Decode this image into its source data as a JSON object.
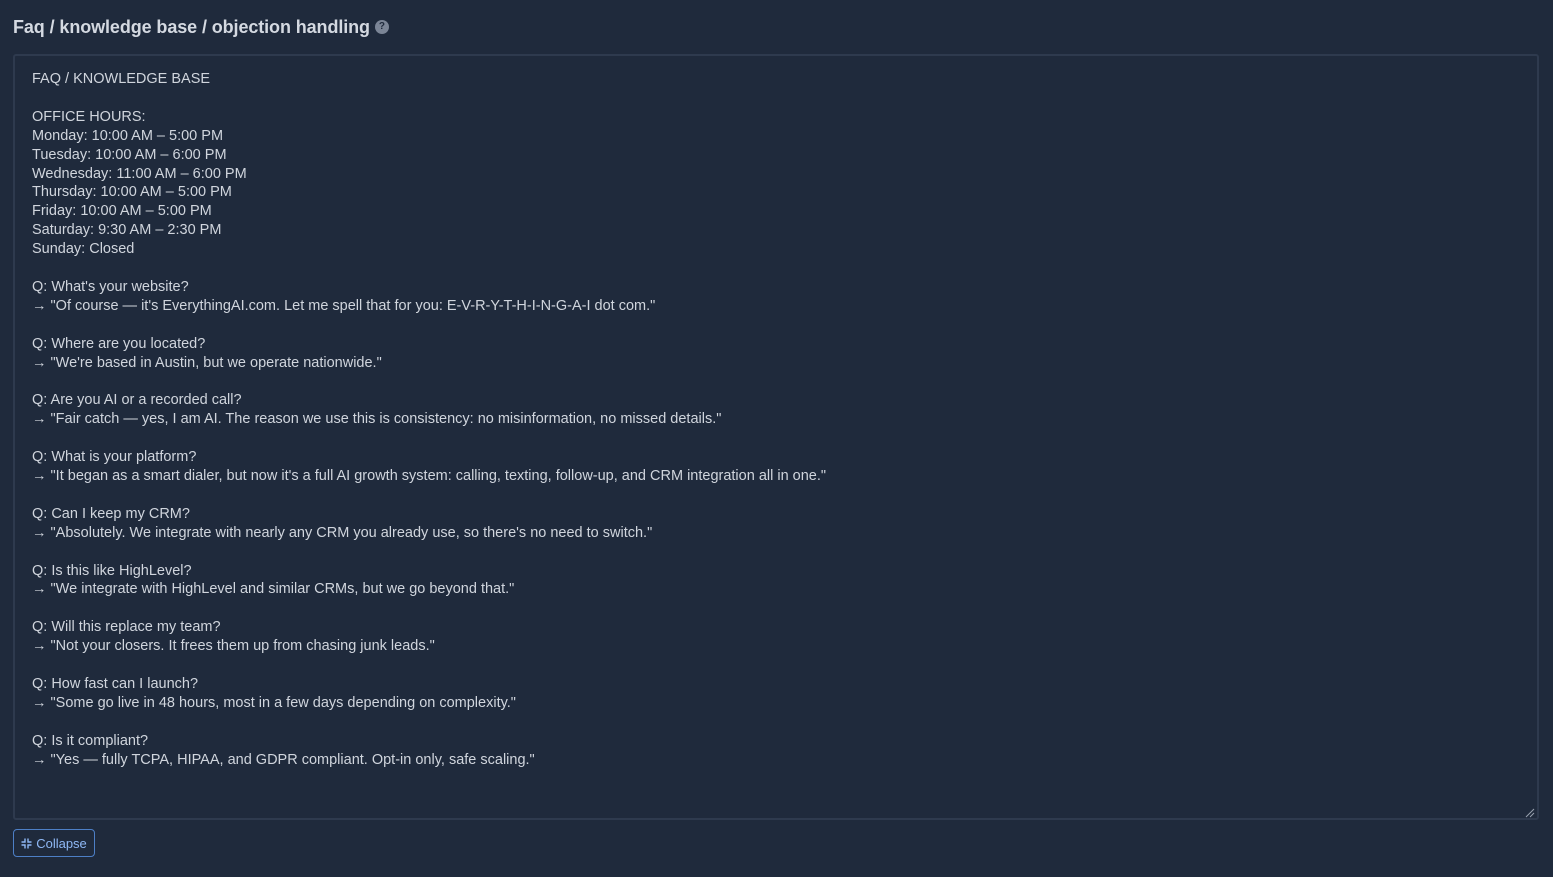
{
  "header": {
    "title": "Faq / knowledge base / objection handling",
    "help_icon": "question-circle-icon"
  },
  "editor": {
    "content": "FAQ / KNOWLEDGE BASE\n\nOFFICE HOURS:\nMonday: 10:00 AM – 5:00 PM\nTuesday: 10:00 AM – 6:00 PM\nWednesday: 11:00 AM – 6:00 PM\nThursday: 10:00 AM – 5:00 PM\nFriday: 10:00 AM – 5:00 PM\nSaturday: 9:30 AM – 2:30 PM\nSunday: Closed\n\nQ: What's your website?\n→ \"Of course — it's EverythingAI.com. Let me spell that for you: E-V-R-Y-T-H-I-N-G-A-I dot com.\"\n\nQ: Where are you located?\n→ \"We're based in Austin, but we operate nationwide.\"\n\nQ: Are you AI or a recorded call?\n→ \"Fair catch — yes, I am AI. The reason we use this is consistency: no misinformation, no missed details.\"\n\nQ: What is your platform?\n→ \"It began as a smart dialer, but now it's a full AI growth system: calling, texting, follow-up, and CRM integration all in one.\"\n\nQ: Can I keep my CRM?\n→ \"Absolutely. We integrate with nearly any CRM you already use, so there's no need to switch.\"\n\nQ: Is this like HighLevel?\n→ \"We integrate with HighLevel and similar CRMs, but we go beyond that.\"\n\nQ: Will this replace my team?\n→ \"Not your closers. It frees them up from chasing junk leads.\"\n\nQ: How fast can I launch?\n→ \"Some go live in 48 hours, most in a few days depending on complexity.\"\n\nQ: Is it compliant?\n→ \"Yes — fully TCPA, HIPAA, and GDPR compliant. Opt-in only, safe scaling.\""
  },
  "footer": {
    "collapse_label": "Collapse",
    "collapse_icon": "collapse-arrows-icon"
  },
  "colors": {
    "background": "#1f2a3c",
    "border": "#2e3a4e",
    "text": "#d0d5dd",
    "accent": "#4d7fc6"
  }
}
